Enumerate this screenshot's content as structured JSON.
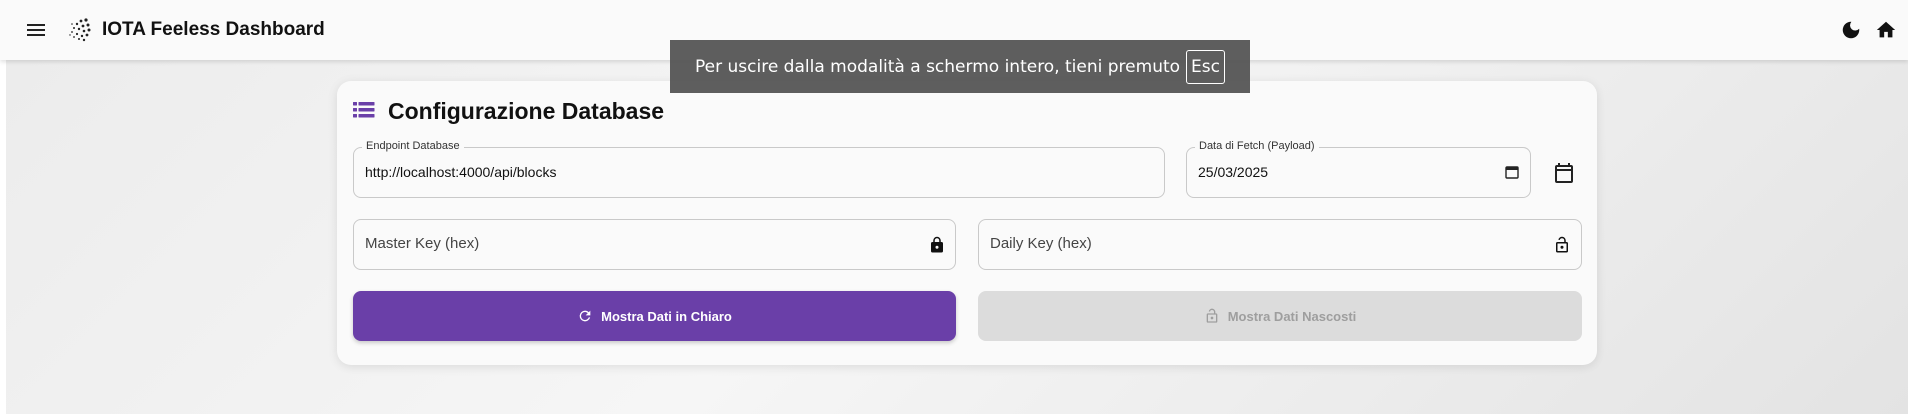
{
  "app_bar": {
    "title": "IOTA Feeless Dashboard",
    "icons": [
      "menu-icon",
      "iota-logo",
      "dark-mode-icon",
      "home-icon"
    ]
  },
  "fullscreen_toast": {
    "message": "Per uscire dalla modalità a schermo intero, tieni premuto",
    "key": "Esc"
  },
  "card": {
    "title": "Configurazione Database",
    "icon": "database-list-icon",
    "endpoint": {
      "label": "Endpoint Database",
      "value": "http://localhost:4000/api/blocks"
    },
    "fetch_date": {
      "label": "Data di Fetch (Payload)",
      "value": "25/03/2025"
    },
    "master_key": {
      "placeholder": "Master Key (hex)",
      "icon": "lock-icon"
    },
    "daily_key": {
      "placeholder": "Daily Key (hex)",
      "icon": "lock-open-icon"
    },
    "show_clear_button": {
      "label": "Mostra Dati in Chiaro",
      "icon": "refresh-icon"
    },
    "show_hidden_button": {
      "label": "Mostra Dati Nascosti",
      "icon": "lock-open-icon",
      "disabled": true
    }
  },
  "colors": {
    "primary": "#6a3fa8",
    "disabled_bg": "#dcdcdc",
    "disabled_text": "#9e9e9e",
    "toast_bg": "#505050"
  }
}
